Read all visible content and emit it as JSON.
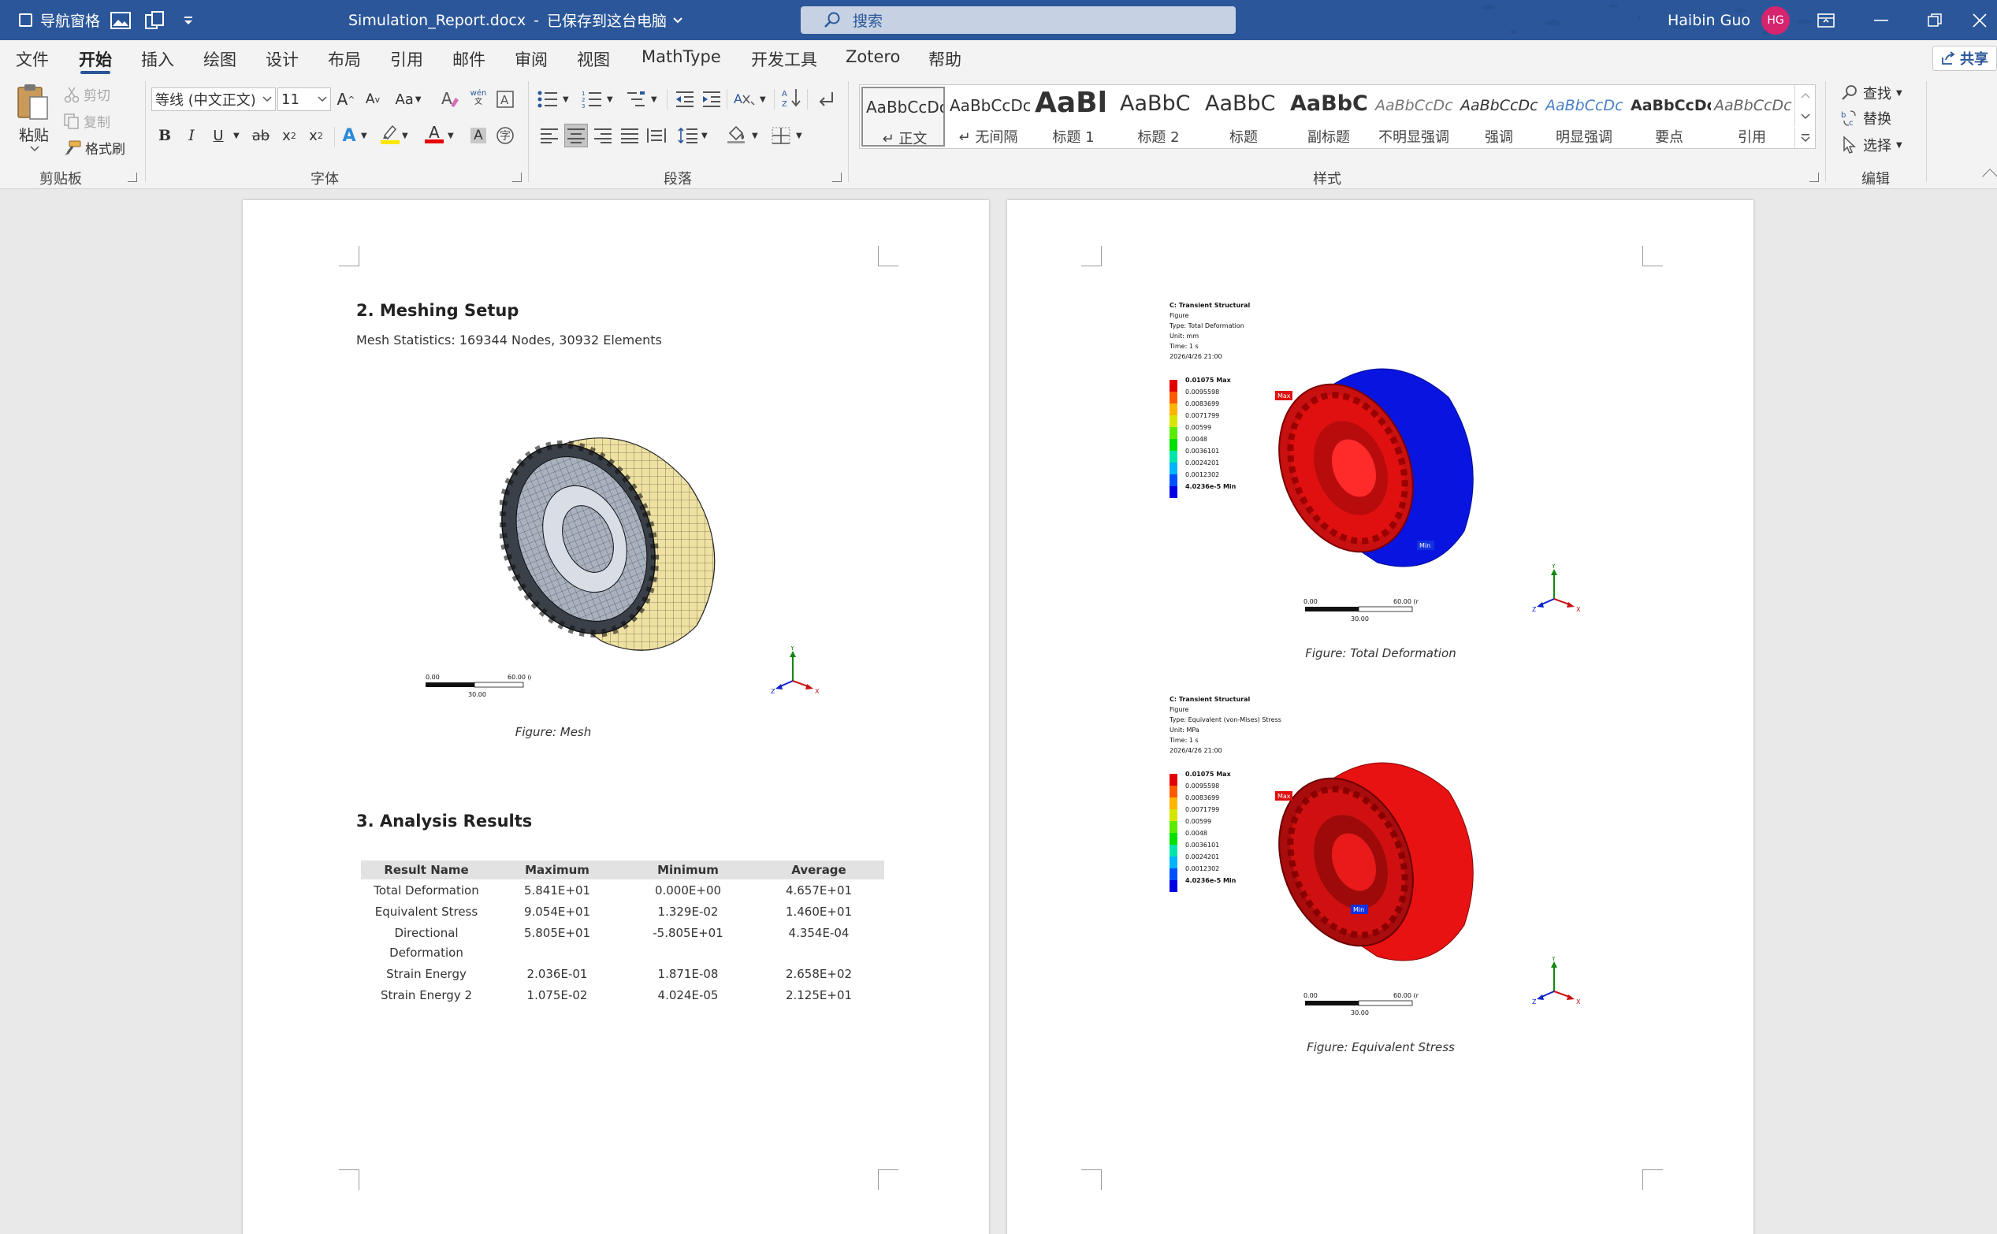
{
  "titlebar": {
    "nav_pane_label": "导航窗格",
    "doc_title": "Simulation_Report.docx",
    "save_status": "已保存到这台电脑",
    "search_placeholder": "搜索",
    "user_name": "Haibin Guo",
    "user_initials": "HG"
  },
  "menu": {
    "tabs": [
      "文件",
      "开始",
      "插入",
      "绘图",
      "设计",
      "布局",
      "引用",
      "邮件",
      "审阅",
      "视图",
      "MathType",
      "开发工具",
      "Zotero",
      "帮助"
    ],
    "active_index": 1,
    "share_label": "共享"
  },
  "ribbon": {
    "clipboard": {
      "paste": "粘贴",
      "cut": "剪切",
      "copy": "复制",
      "format_painter": "格式刷",
      "label": "剪贴板"
    },
    "font": {
      "font_name": "等线 (中文正文)",
      "font_size": "11",
      "change_case": "Aa",
      "phonetic": "wén",
      "label": "字体",
      "bold": "B",
      "italic": "I",
      "underline": "U",
      "strike": "ab",
      "text_effect": "A",
      "font_color": "A",
      "char_shading": "A"
    },
    "paragraph": {
      "label": "段落"
    },
    "styles": {
      "label": "样式",
      "items": [
        {
          "sample": "AaBbCcDc",
          "name": "正文"
        },
        {
          "sample": "AaBbCcDc",
          "name": "无间隔"
        },
        {
          "sample": "AaBl",
          "name": "标题 1"
        },
        {
          "sample": "AaBbC",
          "name": "标题 2"
        },
        {
          "sample": "AaBbC",
          "name": "标题"
        },
        {
          "sample": "AaBbC",
          "name": "副标题"
        },
        {
          "sample": "AaBbCcDc",
          "name": "不明显强调"
        },
        {
          "sample": "AaBbCcDc",
          "name": "强调"
        },
        {
          "sample": "AaBbCcDc",
          "name": "明显强调"
        },
        {
          "sample": "AaBbCcDc",
          "name": "要点"
        },
        {
          "sample": "AaBbCcDc",
          "name": "引用"
        }
      ]
    },
    "editing": {
      "find": "查找",
      "replace": "替换",
      "select": "选择",
      "label": "编辑"
    }
  },
  "page1": {
    "heading_mesh": "2. Meshing Setup",
    "mesh_stats": "Mesh Statistics: 169344 Nodes, 30932 Elements",
    "scale_left": "0.00",
    "scale_right": "60.00 (mm)",
    "scale_mid": "30.00",
    "caption_mesh": "Figure: Mesh",
    "heading_results": "3. Analysis Results",
    "table": {
      "headers": [
        "Result Name",
        "Maximum",
        "Minimum",
        "Average"
      ],
      "rows": [
        [
          "Total Deformation",
          "5.841E+01",
          "0.000E+00",
          "4.657E+01"
        ],
        [
          "Equivalent Stress",
          "9.054E+01",
          "1.329E-02",
          "1.460E+01"
        ],
        [
          "Directional\nDeformation",
          "5.805E+01",
          "-5.805E+01",
          "4.354E-04"
        ],
        [
          "Strain Energy",
          "2.036E-01",
          "1.871E-08",
          "2.658E+02"
        ],
        [
          "Strain Energy 2",
          "1.075E-02",
          "4.024E-05",
          "2.125E+01"
        ]
      ]
    }
  },
  "page2": {
    "fig1": {
      "header": [
        "C: Transient Structural",
        "Figure",
        "Type: Total Deformation",
        "Unit: mm",
        "Time: 1 s",
        "2026/4/26 21:00"
      ],
      "legend": [
        "0.01075 Max",
        "0.0095598",
        "0.0083699",
        "0.0071799",
        "0.00599",
        "0.0048",
        "0.0036101",
        "0.0024201",
        "0.0012302",
        "4.0236e-5 Min"
      ],
      "max_tag": "Max",
      "min_tag": "Min",
      "scale_left": "0.00",
      "scale_right": "60.00 (mm)",
      "scale_mid": "30.00",
      "caption": "Figure: Total Deformation",
      "colors": {
        "body": "#0a14e0",
        "face": "#e01010"
      }
    },
    "fig2": {
      "header": [
        "C: Transient Structural",
        "Figure",
        "Type: Equivalent (von-Mises) Stress",
        "Unit: MPa",
        "Time: 1 s",
        "2026/4/26 21:00"
      ],
      "legend": [
        "0.01075 Max",
        "0.0095598",
        "0.0083699",
        "0.0071799",
        "0.00599",
        "0.0048",
        "0.0036101",
        "0.0024201",
        "0.0012302",
        "4.0236e-5 Min"
      ],
      "max_tag": "Max",
      "min_tag": "Min",
      "scale_left": "0.00",
      "scale_right": "60.00 (mm)",
      "scale_mid": "30.00",
      "caption": "Figure: Equivalent Stress",
      "colors": {
        "body": "#e01010",
        "face": "#e01010"
      }
    },
    "legend_colors": [
      "#e30000",
      "#ff5a00",
      "#ffb400",
      "#d7e600",
      "#5aeb00",
      "#00e100",
      "#00e6aa",
      "#00b4ff",
      "#0050ff",
      "#0000e6"
    ],
    "triad": {
      "x": "X",
      "y": "Y",
      "z": "Z"
    }
  },
  "accent": "#2b579a"
}
